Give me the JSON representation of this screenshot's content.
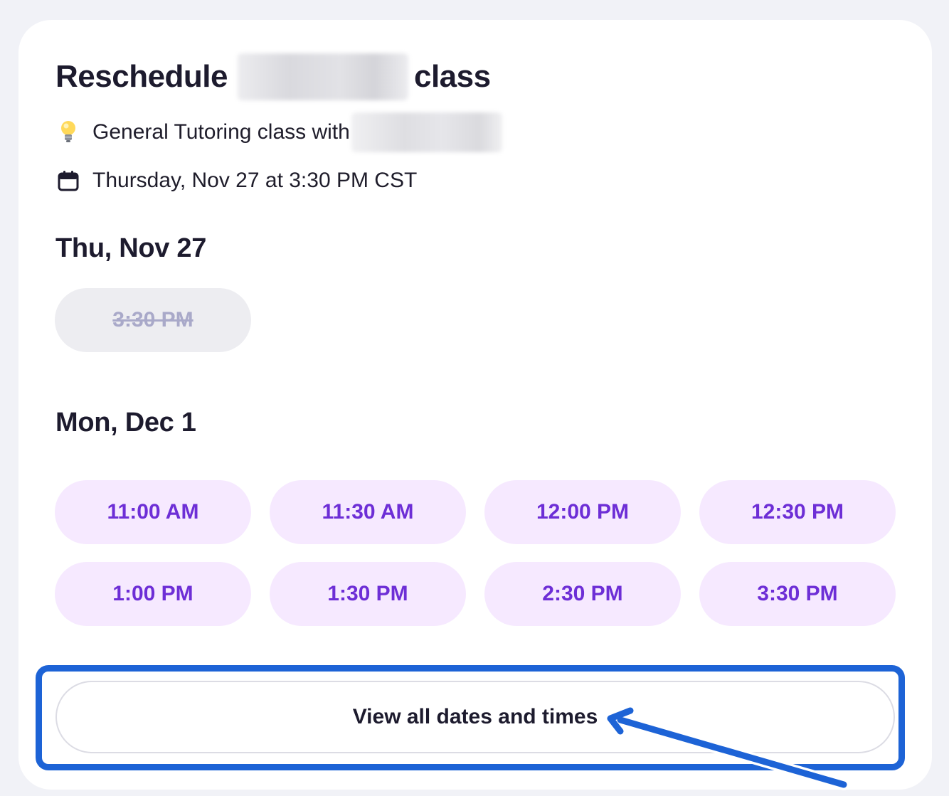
{
  "header": {
    "title_prefix": "Reschedule",
    "title_suffix": "class"
  },
  "info": {
    "tutoring_text": "General Tutoring class with",
    "current_time": "Thursday, Nov 27 at 3:30 PM CST",
    "tutoring_icon": "lightbulb-icon",
    "date_icon": "calendar-icon"
  },
  "days": [
    {
      "heading": "Thu, Nov 27",
      "slots": [
        {
          "label": "3:30 PM",
          "available": false
        }
      ]
    },
    {
      "heading": "Mon, Dec 1",
      "slots": [
        {
          "label": "11:00 AM",
          "available": true
        },
        {
          "label": "11:30 AM",
          "available": true
        },
        {
          "label": "12:00 PM",
          "available": true
        },
        {
          "label": "12:30 PM",
          "available": true
        },
        {
          "label": "1:00 PM",
          "available": true
        },
        {
          "label": "1:30 PM",
          "available": true
        },
        {
          "label": "2:30 PM",
          "available": true
        },
        {
          "label": "3:30 PM",
          "available": true
        }
      ]
    }
  ],
  "view_all_label": "View all dates and times",
  "colors": {
    "slot_background": "#f6e9ff",
    "slot_text": "#6d2ed6",
    "disabled_slot_background": "#ededf1",
    "disabled_slot_text": "#a9a9c9",
    "annotation": "#1d63d6"
  }
}
